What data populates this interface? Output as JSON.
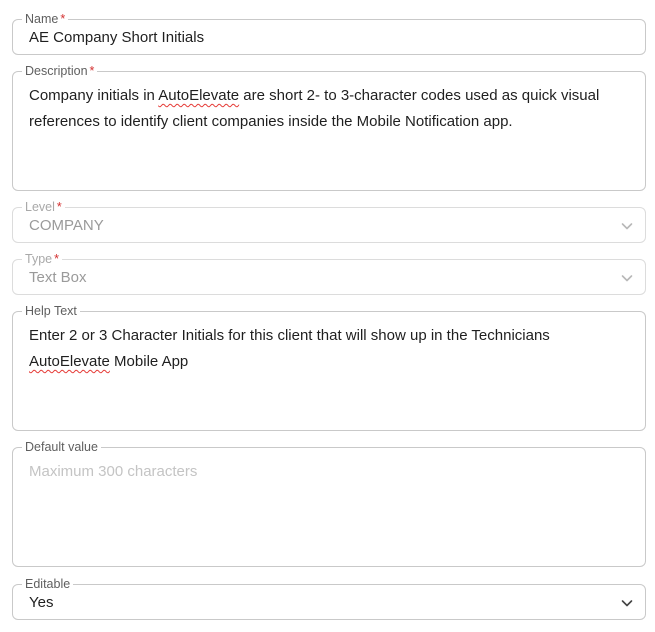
{
  "form": {
    "name": {
      "label": "Name",
      "required_mark": "*",
      "value": "AE Company Short Initials"
    },
    "description": {
      "label": "Description",
      "required_mark": "*",
      "text_before": "Company initials in ",
      "misspelled": "AutoElevate",
      "text_after": " are short 2- to 3-character codes used as quick visual references to identify client companies inside the Mobile Notification app."
    },
    "level": {
      "label": "Level",
      "required_mark": "*",
      "value": "COMPANY",
      "icon": "chevron-down-icon"
    },
    "type": {
      "label": "Type",
      "required_mark": "*",
      "value": "Text Box",
      "icon": "chevron-down-icon"
    },
    "help_text": {
      "label": "Help Text",
      "text_before": "Enter 2 or 3 Character Initials for this client that will show up in the Technicians ",
      "misspelled": "AutoElevate",
      "text_after": " Mobile App"
    },
    "default_value": {
      "label": "Default value",
      "placeholder": "Maximum 300 characters"
    },
    "editable": {
      "label": "Editable",
      "value": "Yes",
      "icon": "chevron-down-icon"
    }
  }
}
